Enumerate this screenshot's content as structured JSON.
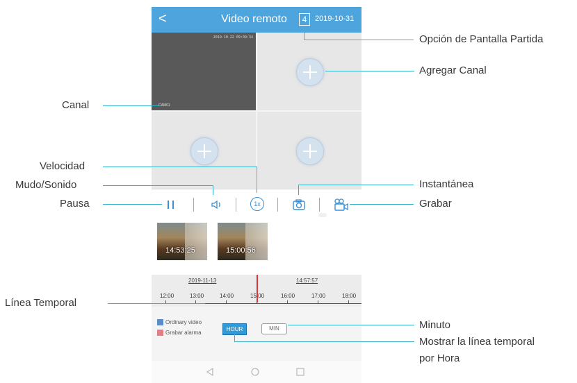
{
  "app": {
    "back_glyph": "<",
    "title": "Video remoto",
    "split_count": "4",
    "date": "2019-10-31"
  },
  "feed": {
    "timestamp": "2019-10-22 09:09:34",
    "camera_label": "CAM01"
  },
  "controls": [
    "pause-icon",
    "speaker-icon",
    "speed-icon",
    "camera-icon",
    "video-record-icon"
  ],
  "speed_label": "1x",
  "thumbnails": [
    {
      "time": "14:53:25"
    },
    {
      "time": "15:00:56"
    }
  ],
  "timeline": {
    "date": "2019-11-13",
    "time": "14:57:57",
    "ticks": [
      "12:00",
      "13:00",
      "14:00",
      "15:00",
      "16:00",
      "17:00",
      "18:00"
    ],
    "cursor_color": "#d9343e"
  },
  "legend": {
    "ordinary": "Ordinary video",
    "alarm": "Grabar alarma",
    "ordinary_color": "#5b8cc8",
    "alarm_color": "#e57d86"
  },
  "buttons": {
    "hour": "HOUR",
    "min": "MIN"
  },
  "annotations": {
    "split": "Opción de Pantalla Partida",
    "add_channel": "Agregar Canal",
    "channel": "Canal",
    "speed": "Velocidad",
    "mute": "Mudo/Sonido",
    "pause": "Pausa",
    "snapshot": "Instantánea",
    "record": "Grabar",
    "timeline": "Línea Temporal",
    "minute": "Minuto",
    "hour_line1": "Mostrar la línea temporal",
    "hour_line2": "por Hora"
  },
  "colors": {
    "header": "#4ea4dc",
    "callout_line": "#35b1c9",
    "icon": "#3b8fd2"
  }
}
